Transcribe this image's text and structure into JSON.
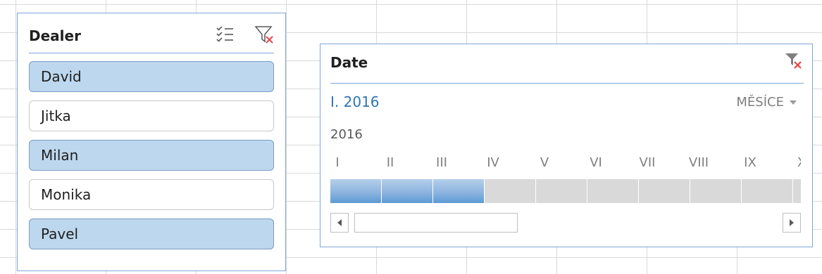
{
  "dealer_slicer": {
    "title": "Dealer",
    "icons": {
      "multiselect": "multi-select-icon",
      "clear_filter": "clear-filter-icon"
    },
    "items": [
      {
        "label": "David",
        "selected": true
      },
      {
        "label": "Jitka",
        "selected": false
      },
      {
        "label": "Milan",
        "selected": true
      },
      {
        "label": "Monika",
        "selected": false
      },
      {
        "label": "Pavel",
        "selected": true
      }
    ]
  },
  "date_timeline": {
    "title": "Date",
    "range_label": "I. 2016",
    "level_label": "MĚSÍCE",
    "year": "2016",
    "months": [
      "I",
      "II",
      "III",
      "IV",
      "V",
      "VI",
      "VII",
      "VIII",
      "IX",
      "X"
    ],
    "selected_months": [
      0,
      1,
      2
    ],
    "icons": {
      "clear_filter": "clear-filter-icon",
      "scroll_left": "arrow-left-icon",
      "scroll_right": "arrow-right-icon"
    }
  },
  "colors": {
    "selected_item": "#bdd7ee",
    "border_accent": "#7ea6d8",
    "range_text": "#2e75b6",
    "timeline_selected": "#5b9bd5",
    "timeline_unselected": "#d9d9d9",
    "clear_x": "#e84545"
  }
}
